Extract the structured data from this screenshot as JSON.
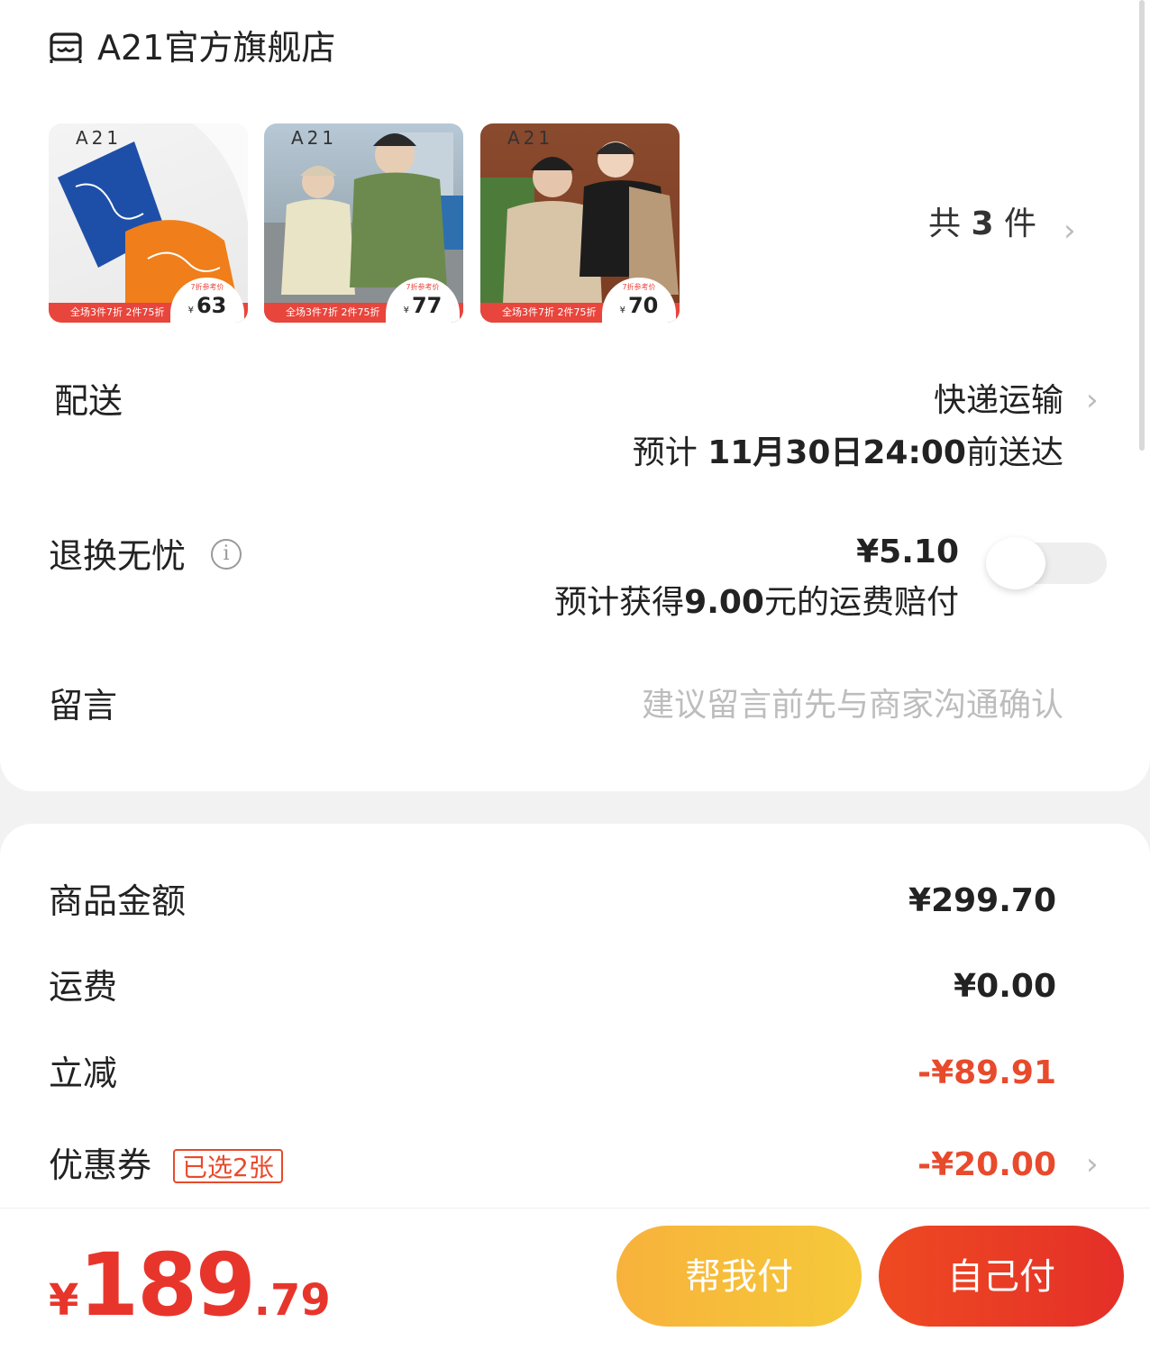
{
  "store": {
    "name": "A21官方旗舰店",
    "icon": "store-icon"
  },
  "products": {
    "items": [
      {
        "brand": "A21",
        "banner": "全场3件7折 2件75折",
        "badge_label": "7折参考价",
        "price_currency": "¥",
        "price": "63"
      },
      {
        "brand": "A21",
        "banner": "全场3件7折 2件75折",
        "badge_label": "7折参考价",
        "price_currency": "¥",
        "price": "77"
      },
      {
        "brand": "A21",
        "banner": "全场3件7折 2件75折",
        "badge_label": "7折参考价",
        "price_currency": "¥",
        "price": "70"
      }
    ],
    "count_prefix": "共",
    "count": "3",
    "count_suffix": "件"
  },
  "delivery": {
    "label": "配送",
    "method": "快递运输",
    "eta_prefix": "预计",
    "eta": "11月30日24:00",
    "eta_suffix": "前送达"
  },
  "return_insurance": {
    "label": "退换无忧",
    "price": "¥5.10",
    "desc_prefix": "预计获得",
    "desc_amount": "9.00",
    "desc_suffix": "元的运费赔付",
    "enabled": false
  },
  "message": {
    "label": "留言",
    "placeholder": "建议留言前先与商家沟通确认"
  },
  "summary": {
    "goods_label": "商品金额",
    "goods_value": "¥299.70",
    "shipping_label": "运费",
    "shipping_value": "¥0.00",
    "discount_label": "立减",
    "discount_value": "-¥89.91",
    "coupon_label": "优惠券",
    "coupon_tag": "已选2张",
    "coupon_value": "-¥20.00"
  },
  "footer": {
    "currency": "¥",
    "total_int": "189",
    "total_dec": ".79",
    "help_pay": "帮我付",
    "self_pay": "自己付"
  },
  "colors": {
    "accent_red": "#e84a2c",
    "help_btn": "#f6bd3b",
    "self_btn": "#e93a26"
  }
}
